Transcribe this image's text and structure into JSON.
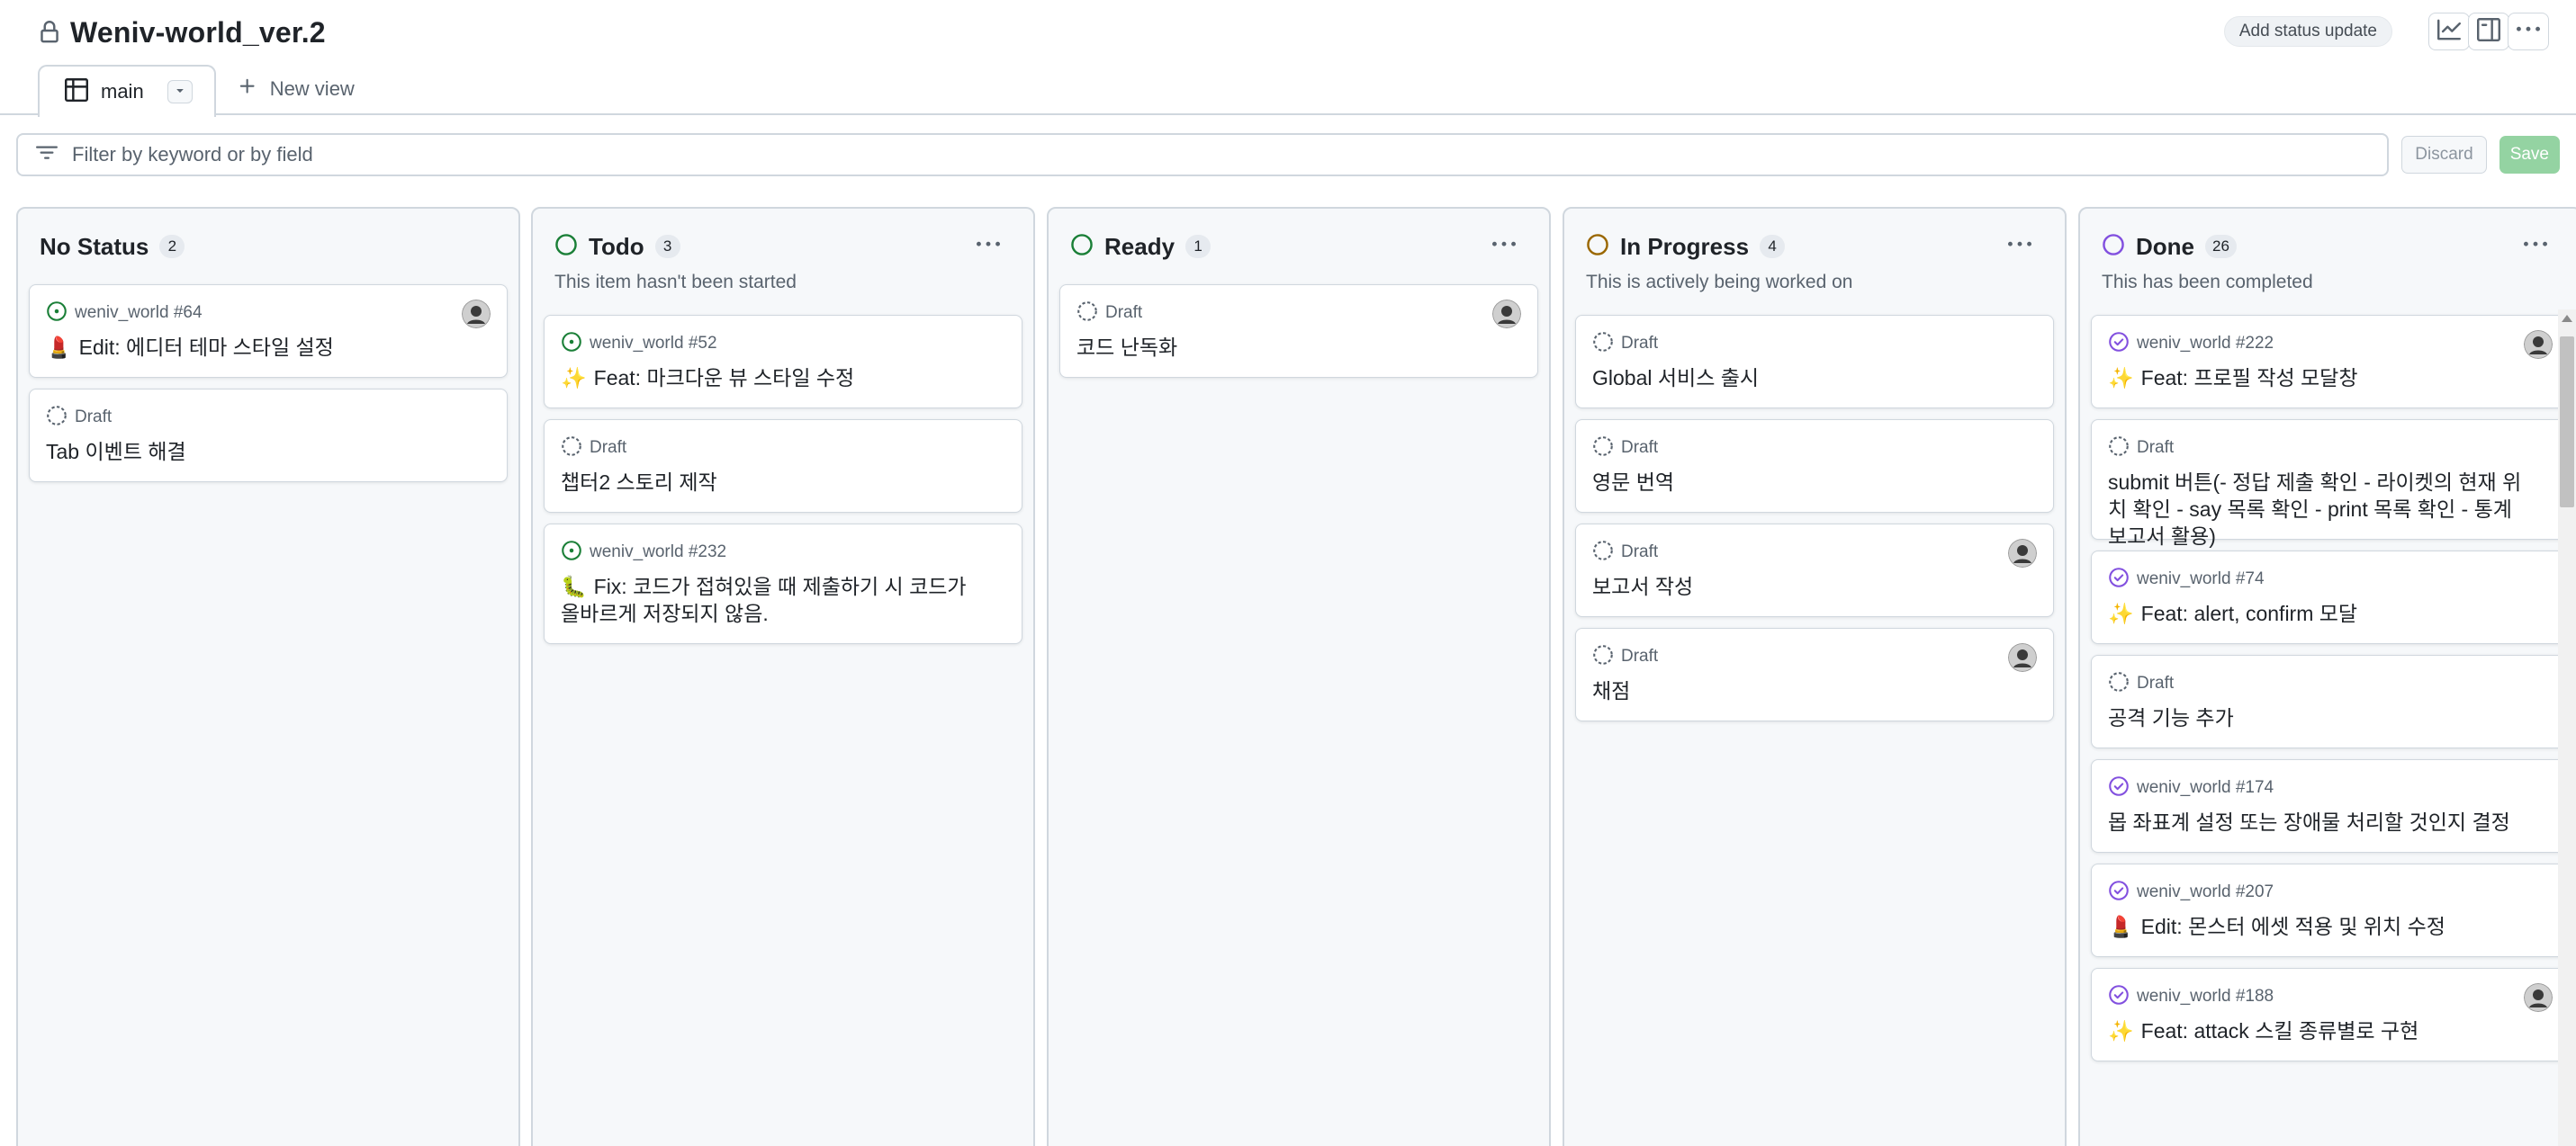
{
  "project": {
    "title": "Weniv-world_ver.2",
    "lock_icon": "lock-icon"
  },
  "header": {
    "status_update_label": "Add status update",
    "actions": [
      "insights-icon",
      "layout-panel-icon",
      "kebab-horizontal-icon"
    ]
  },
  "views": {
    "tabs": [
      {
        "label": "main",
        "icon": "board-icon",
        "active": true
      }
    ],
    "new_view_label": "New view"
  },
  "filter": {
    "placeholder": "Filter by keyword or by field",
    "discard_label": "Discard",
    "save_label": "Save"
  },
  "colors": {
    "todo": "#1a7f37",
    "ready": "#1a7f37",
    "in_progress": "#9a6700",
    "done": "#8250df",
    "draft": "#59636e",
    "save_button": "#94d3a2"
  },
  "columns": [
    {
      "name": "No Status",
      "count": "2",
      "description": "",
      "cards": [
        {
          "kind": "issue-open",
          "meta": "weniv_world #64",
          "emoji": "💄",
          "title": "Edit: 에디터 테마 스타일 설정",
          "avatar": true
        },
        {
          "kind": "draft",
          "meta": "Draft",
          "emoji": "",
          "title": "Tab 이벤트 해결",
          "avatar": false
        }
      ]
    },
    {
      "name": "Todo",
      "count": "3",
      "description": "This item hasn't been started",
      "cards": [
        {
          "kind": "issue-open",
          "meta": "weniv_world #52",
          "emoji": "✨",
          "title": "Feat: 마크다운 뷰 스타일 수정",
          "avatar": false
        },
        {
          "kind": "draft",
          "meta": "Draft",
          "emoji": "",
          "title": "챕터2 스토리 제작",
          "avatar": false
        },
        {
          "kind": "issue-open",
          "meta": "weniv_world #232",
          "emoji": "🐛",
          "title": "Fix: 코드가 접혀있을 때 제출하기 시 코드가 올바르게 저장되지 않음.",
          "avatar": false
        }
      ]
    },
    {
      "name": "Ready",
      "count": "1",
      "description": "",
      "cards": [
        {
          "kind": "draft",
          "meta": "Draft",
          "emoji": "",
          "title": "코드 난독화",
          "avatar": true
        }
      ]
    },
    {
      "name": "In Progress",
      "count": "4",
      "description": "This is actively being worked on",
      "cards": [
        {
          "kind": "draft",
          "meta": "Draft",
          "emoji": "",
          "title": "Global 서비스 출시",
          "avatar": false
        },
        {
          "kind": "draft",
          "meta": "Draft",
          "emoji": "",
          "title": "영문 번역",
          "avatar": false
        },
        {
          "kind": "draft",
          "meta": "Draft",
          "emoji": "",
          "title": "보고서 작성",
          "avatar": true
        },
        {
          "kind": "draft",
          "meta": "Draft",
          "emoji": "",
          "title": "채점",
          "avatar": true
        }
      ]
    },
    {
      "name": "Done",
      "count": "26",
      "description": "This has been completed",
      "cards": [
        {
          "kind": "issue-closed",
          "meta": "weniv_world #222",
          "emoji": "✨",
          "title": "Feat: 프로필 작성 모달창",
          "avatar": true
        },
        {
          "kind": "draft",
          "meta": "Draft",
          "emoji": "",
          "title": "submit 버튼(- 정답 제출 확인 - 라이켓의 현재 위치 확인 - say 목록 확인 - print 목록 확인 - 통계 보고서 활용)",
          "avatar": false
        },
        {
          "kind": "issue-closed",
          "meta": "weniv_world #74",
          "emoji": "✨",
          "title": "Feat: alert, confirm 모달",
          "avatar": false
        },
        {
          "kind": "draft",
          "meta": "Draft",
          "emoji": "",
          "title": "공격 기능 추가",
          "avatar": false
        },
        {
          "kind": "issue-closed",
          "meta": "weniv_world #174",
          "emoji": "",
          "title": "몹 좌표계 설정 또는 장애물 처리할 것인지 결정",
          "avatar": false
        },
        {
          "kind": "issue-closed",
          "meta": "weniv_world #207",
          "emoji": "💄",
          "title": "Edit: 몬스터 에셋 적용 및 위치 수정",
          "avatar": false
        },
        {
          "kind": "issue-closed",
          "meta": "weniv_world #188",
          "emoji": "✨",
          "title": "Feat: attack 스킬 종류별로 구현",
          "avatar": true
        }
      ]
    }
  ]
}
